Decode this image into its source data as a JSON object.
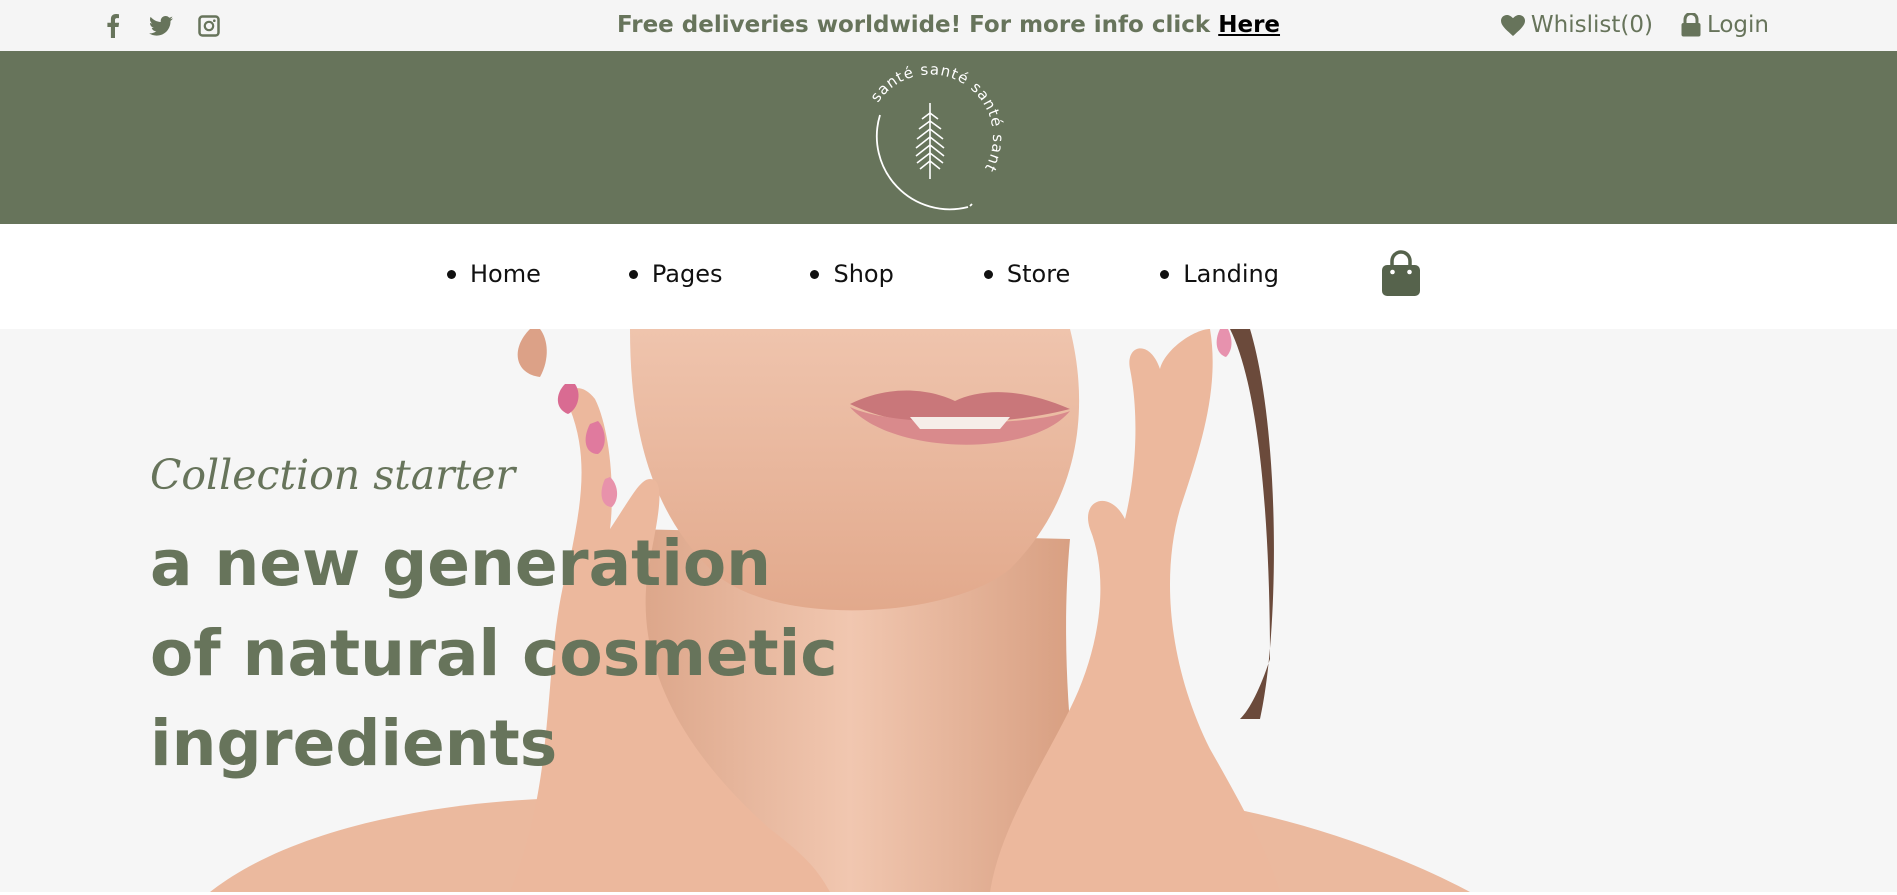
{
  "topbar": {
    "promo_text": "Free deliveries worldwide! For more info click ",
    "promo_link": "Here",
    "wishlist": "Whislist(0)",
    "login": "Login",
    "social_icons": [
      "facebook-icon",
      "twitter-icon",
      "instagram-icon"
    ]
  },
  "header": {
    "logo_text": "santé santé santé santé"
  },
  "nav": {
    "items": [
      {
        "label": "Home"
      },
      {
        "label": "Pages"
      },
      {
        "label": "Shop"
      },
      {
        "label": "Store"
      },
      {
        "label": "Landing"
      }
    ],
    "cart_icon": "shopping-bag-icon"
  },
  "hero": {
    "eyebrow": "Collection starter",
    "headline": "a new generation of natural cosmetic ingredients"
  },
  "colors": {
    "brand_green": "#67745b",
    "topbar_bg": "#f5f5f5",
    "hero_bg": "#f6f6f6"
  }
}
